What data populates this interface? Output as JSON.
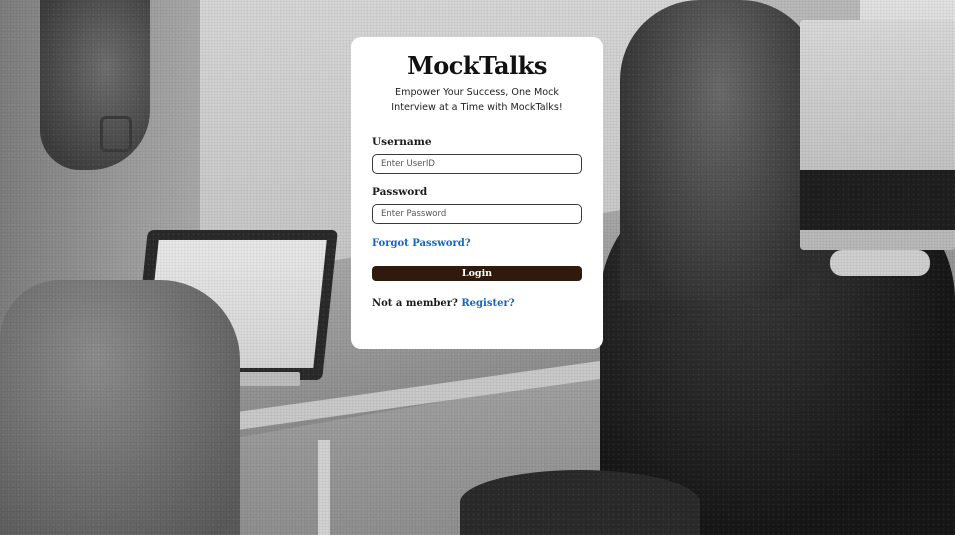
{
  "brand": {
    "title": "MockTalks",
    "tagline": "Empower Your Success, One Mock Interview at a Time with MockTalks!"
  },
  "form": {
    "username_label": "Username",
    "username_placeholder": "Enter UserID",
    "password_label": "Password",
    "password_placeholder": "Enter Password",
    "forgot_password_link": "Forgot Password?",
    "login_button": "Login",
    "register_prompt": "Not a member?",
    "register_link": "Register?"
  },
  "colors": {
    "card_background": "#ffffff",
    "login_button": "#2f1a0d",
    "link": "#1565c0",
    "background_photo": "grayscale office scene with people at laptops"
  }
}
